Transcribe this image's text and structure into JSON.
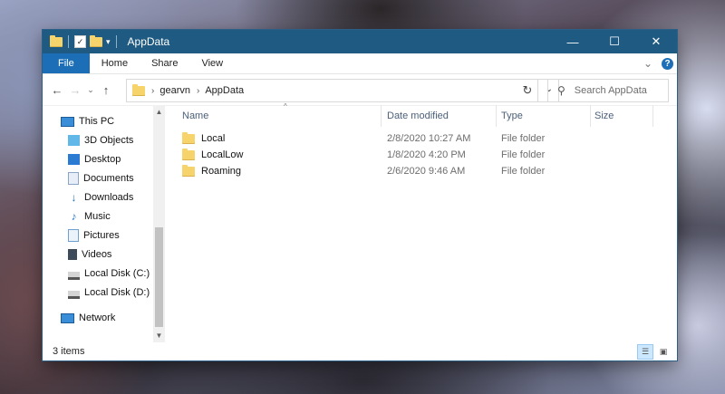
{
  "window": {
    "title": "AppData",
    "controls": {
      "minimize": "—",
      "maximize": "☐",
      "close": "✕"
    }
  },
  "quick_access": {
    "dropdown": "▾"
  },
  "ribbon": {
    "tabs": [
      {
        "label": "File"
      },
      {
        "label": "Home"
      },
      {
        "label": "Share"
      },
      {
        "label": "View"
      }
    ],
    "expand_chevron": "⌄",
    "help": "?"
  },
  "nav_buttons": {
    "back": "←",
    "forward": "→",
    "recent": "⌄",
    "up": "↑"
  },
  "address": {
    "separator": "›",
    "path": [
      "gearvn",
      "AppData"
    ],
    "dropdown": "⌄",
    "refresh": "↻"
  },
  "search": {
    "placeholder": "Search AppData",
    "icon": "⚲"
  },
  "sidebar": {
    "items": [
      {
        "label": "This PC",
        "icon": "pc-icon"
      },
      {
        "label": "3D Objects",
        "icon": "cube-icon"
      },
      {
        "label": "Desktop",
        "icon": "desktop-icon"
      },
      {
        "label": "Documents",
        "icon": "document-icon"
      },
      {
        "label": "Downloads",
        "icon": "download-icon"
      },
      {
        "label": "Music",
        "icon": "music-icon"
      },
      {
        "label": "Pictures",
        "icon": "pictures-icon"
      },
      {
        "label": "Videos",
        "icon": "video-icon"
      },
      {
        "label": "Local Disk (C:)",
        "icon": "drive-icon"
      },
      {
        "label": "Local Disk (D:)",
        "icon": "drive-icon"
      },
      {
        "label": "Network",
        "icon": "network-icon"
      }
    ],
    "scroll_up": "▲",
    "scroll_down": "▼"
  },
  "columns": {
    "name": "Name",
    "date": "Date modified",
    "type": "Type",
    "size": "Size",
    "sort_indicator": "^"
  },
  "files": [
    {
      "name": "Local",
      "date": "2/8/2020 10:27 AM",
      "type": "File folder"
    },
    {
      "name": "LocalLow",
      "date": "1/8/2020 4:20 PM",
      "type": "File folder"
    },
    {
      "name": "Roaming",
      "date": "2/6/2020 9:46 AM",
      "type": "File folder"
    }
  ],
  "status": {
    "count": "3 items"
  },
  "colors": {
    "titlebar": "#1f5a82",
    "file_tab": "#1c6fb6",
    "folder": "#f6d36b"
  }
}
